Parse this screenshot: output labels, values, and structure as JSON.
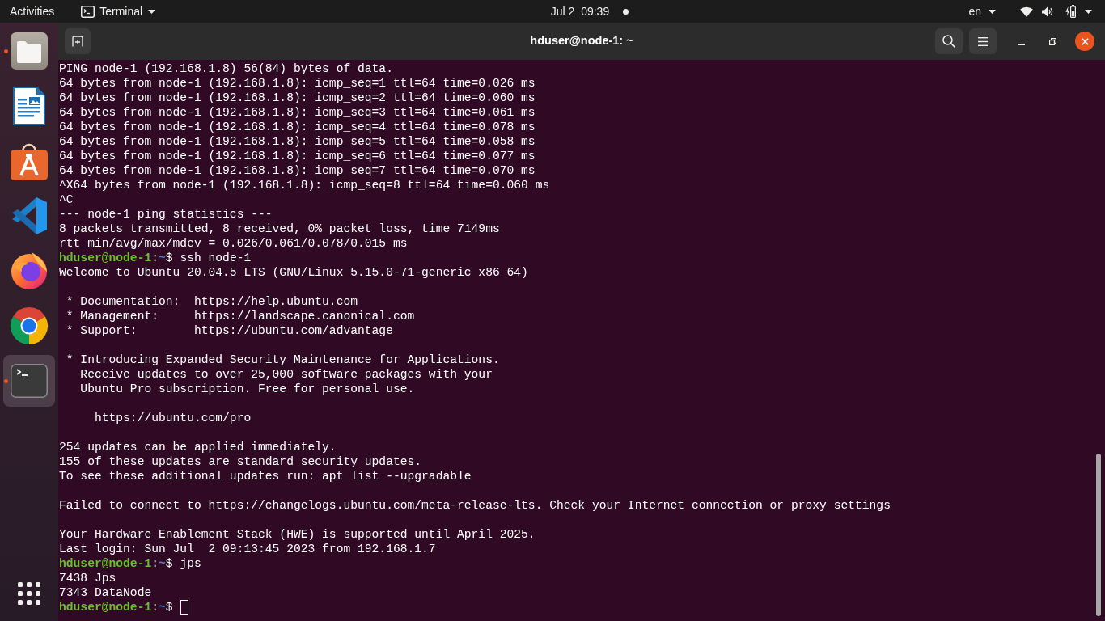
{
  "top_bar": {
    "activities": "Activities",
    "app_menu": "Terminal",
    "clock": "Jul 2  09:39",
    "input_source": "en"
  },
  "dock": {
    "items": [
      {
        "kind": "files",
        "running": true,
        "selected": false
      },
      {
        "kind": "writer",
        "running": false,
        "selected": false
      },
      {
        "kind": "software",
        "running": false,
        "selected": false
      },
      {
        "kind": "vscode",
        "running": false,
        "selected": false
      },
      {
        "kind": "firefox",
        "running": false,
        "selected": false
      },
      {
        "kind": "chrome",
        "running": false,
        "selected": false
      },
      {
        "kind": "terminal",
        "running": true,
        "selected": true
      }
    ]
  },
  "window": {
    "title": "hduser@node-1: ~"
  },
  "terminal": {
    "lines": [
      {
        "kind": "output",
        "text": "PING node-1 (192.168.1.8) 56(84) bytes of data."
      },
      {
        "kind": "output",
        "text": "64 bytes from node-1 (192.168.1.8): icmp_seq=1 ttl=64 time=0.026 ms"
      },
      {
        "kind": "output",
        "text": "64 bytes from node-1 (192.168.1.8): icmp_seq=2 ttl=64 time=0.060 ms"
      },
      {
        "kind": "output",
        "text": "64 bytes from node-1 (192.168.1.8): icmp_seq=3 ttl=64 time=0.061 ms"
      },
      {
        "kind": "output",
        "text": "64 bytes from node-1 (192.168.1.8): icmp_seq=4 ttl=64 time=0.078 ms"
      },
      {
        "kind": "output",
        "text": "64 bytes from node-1 (192.168.1.8): icmp_seq=5 ttl=64 time=0.058 ms"
      },
      {
        "kind": "output",
        "text": "64 bytes from node-1 (192.168.1.8): icmp_seq=6 ttl=64 time=0.077 ms"
      },
      {
        "kind": "output",
        "text": "64 bytes from node-1 (192.168.1.8): icmp_seq=7 ttl=64 time=0.070 ms"
      },
      {
        "kind": "output",
        "text": "^X64 bytes from node-1 (192.168.1.8): icmp_seq=8 ttl=64 time=0.060 ms"
      },
      {
        "kind": "output",
        "text": "^C"
      },
      {
        "kind": "output",
        "text": "--- node-1 ping statistics ---"
      },
      {
        "kind": "output",
        "text": "8 packets transmitted, 8 received, 0% packet loss, time 7149ms"
      },
      {
        "kind": "output",
        "text": "rtt min/avg/max/mdev = 0.026/0.061/0.078/0.015 ms"
      },
      {
        "kind": "prompt",
        "user": "hduser@node-1",
        "separator": ":",
        "path": "~",
        "symbol": "$",
        "command": "ssh node-1",
        "cursor": false
      },
      {
        "kind": "output",
        "text": "Welcome to Ubuntu 20.04.5 LTS (GNU/Linux 5.15.0-71-generic x86_64)"
      },
      {
        "kind": "blank"
      },
      {
        "kind": "output",
        "text": " * Documentation:  https://help.ubuntu.com"
      },
      {
        "kind": "output",
        "text": " * Management:     https://landscape.canonical.com"
      },
      {
        "kind": "output",
        "text": " * Support:        https://ubuntu.com/advantage"
      },
      {
        "kind": "blank"
      },
      {
        "kind": "output",
        "text": " * Introducing Expanded Security Maintenance for Applications."
      },
      {
        "kind": "output",
        "text": "   Receive updates to over 25,000 software packages with your"
      },
      {
        "kind": "output",
        "text": "   Ubuntu Pro subscription. Free for personal use."
      },
      {
        "kind": "blank"
      },
      {
        "kind": "output",
        "text": "     https://ubuntu.com/pro"
      },
      {
        "kind": "blank"
      },
      {
        "kind": "output",
        "text": "254 updates can be applied immediately."
      },
      {
        "kind": "output",
        "text": "155 of these updates are standard security updates."
      },
      {
        "kind": "output",
        "text": "To see these additional updates run: apt list --upgradable"
      },
      {
        "kind": "blank"
      },
      {
        "kind": "output",
        "text": "Failed to connect to https://changelogs.ubuntu.com/meta-release-lts. Check your Internet connection or proxy settings"
      },
      {
        "kind": "blank"
      },
      {
        "kind": "output",
        "text": "Your Hardware Enablement Stack (HWE) is supported until April 2025."
      },
      {
        "kind": "output",
        "text": "Last login: Sun Jul  2 09:13:45 2023 from 192.168.1.7"
      },
      {
        "kind": "prompt",
        "user": "hduser@node-1",
        "separator": ":",
        "path": "~",
        "symbol": "$",
        "command": "jps",
        "cursor": false
      },
      {
        "kind": "output",
        "text": "7438 Jps"
      },
      {
        "kind": "output",
        "text": "7343 DataNode"
      },
      {
        "kind": "prompt",
        "user": "hduser@node-1",
        "separator": ":",
        "path": "~",
        "symbol": "$",
        "cursor": true
      }
    ]
  }
}
